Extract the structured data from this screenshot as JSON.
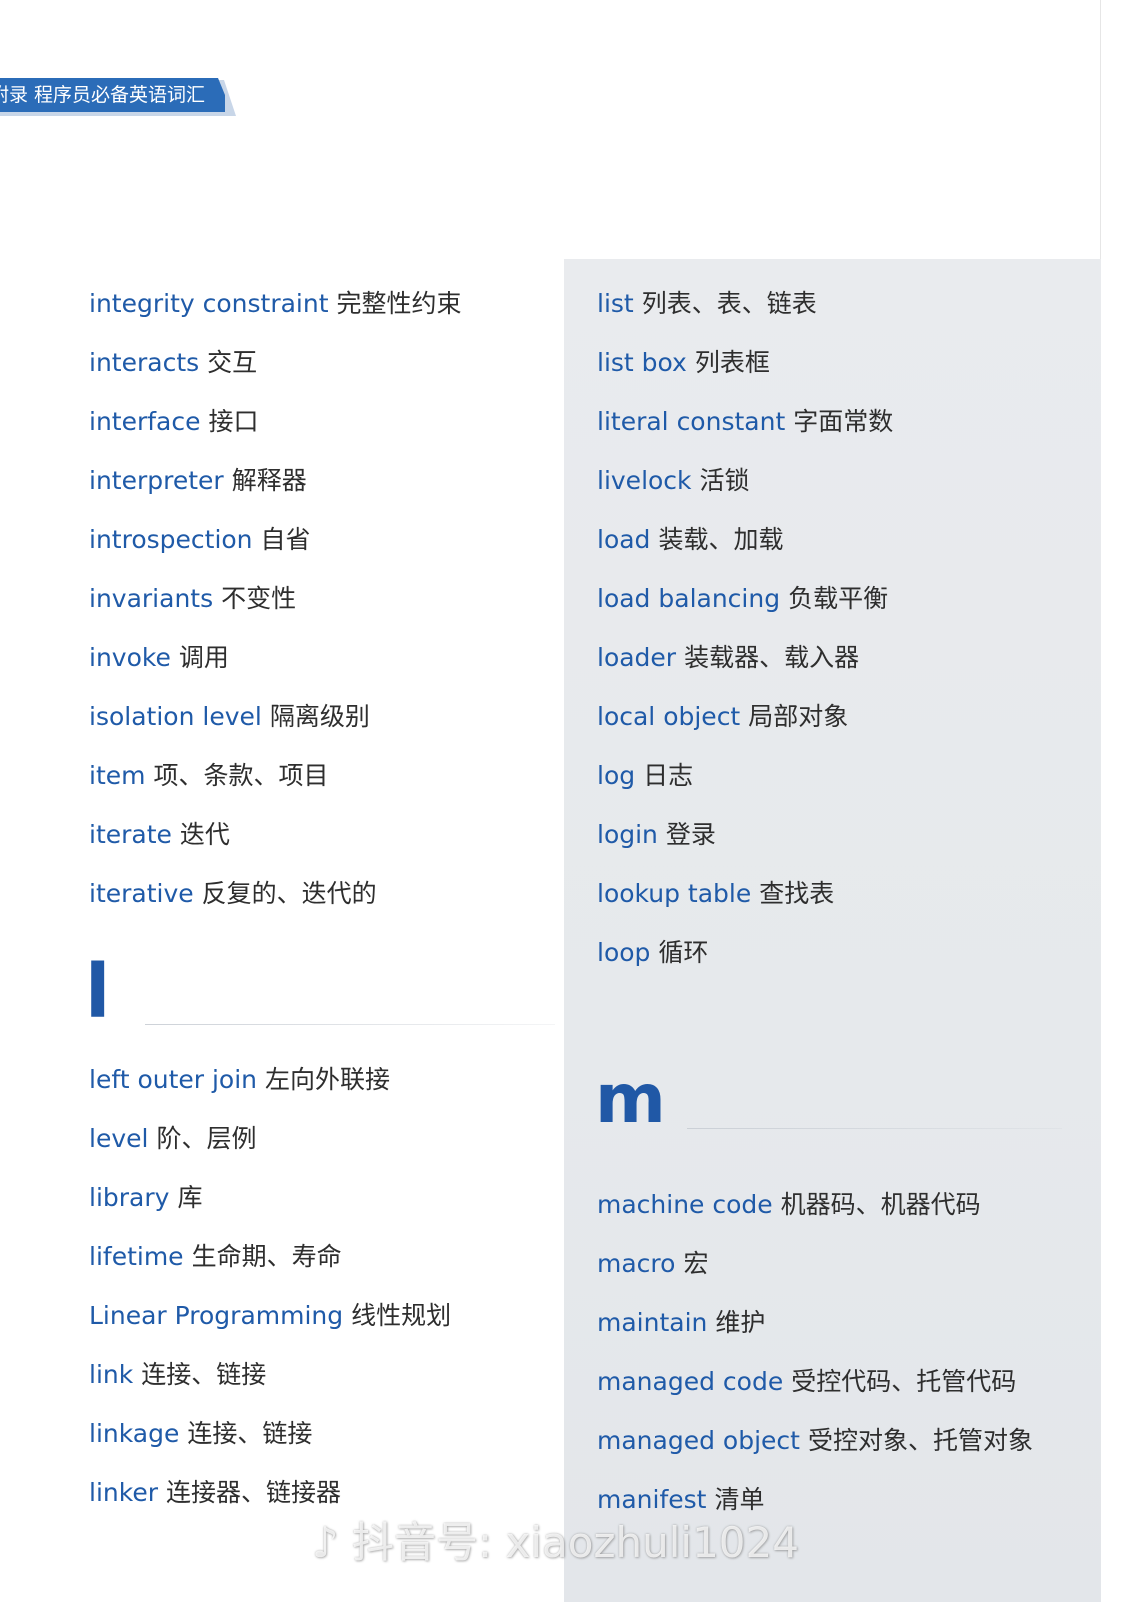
{
  "header": {
    "title": "附录 程序员必备英语词汇"
  },
  "left_column": {
    "entries_top": [
      {
        "en": "integrity constraint",
        "zh": "完整性约束"
      },
      {
        "en": "interacts",
        "zh": "交互"
      },
      {
        "en": "interface",
        "zh": "接口"
      },
      {
        "en": "interpreter",
        "zh": "解释器"
      },
      {
        "en": "introspection",
        "zh": "自省"
      },
      {
        "en": "invariants",
        "zh": "不变性"
      },
      {
        "en": "invoke",
        "zh": "调用"
      },
      {
        "en": "isolation level",
        "zh": "隔离级别"
      },
      {
        "en": "item",
        "zh": "项、条款、项目"
      },
      {
        "en": "iterate",
        "zh": "迭代"
      },
      {
        "en": "iterative",
        "zh": "反复的、迭代的"
      }
    ],
    "section_letter": "l",
    "entries_bottom": [
      {
        "en": "left outer join",
        "zh": "左向外联接"
      },
      {
        "en": "level",
        "zh": "阶、层例"
      },
      {
        "en": "library",
        "zh": "库"
      },
      {
        "en": "lifetime",
        "zh": "生命期、寿命"
      },
      {
        "en": "Linear Programming",
        "zh": "线性规划"
      },
      {
        "en": "link",
        "zh": "连接、链接"
      },
      {
        "en": "linkage",
        "zh": "连接、链接"
      },
      {
        "en": "linker",
        "zh": "连接器、链接器"
      }
    ]
  },
  "right_column": {
    "entries_top": [
      {
        "en": "list",
        "zh": "列表、表、链表"
      },
      {
        "en": "list box",
        "zh": "列表框"
      },
      {
        "en": "literal constant",
        "zh": "字面常数"
      },
      {
        "en": "livelock",
        "zh": "活锁"
      },
      {
        "en": "load",
        "zh": "装载、加载"
      },
      {
        "en": "load balancing",
        "zh": "负载平衡"
      },
      {
        "en": "loader",
        "zh": "装载器、载入器"
      },
      {
        "en": "local object",
        "zh": "局部对象"
      },
      {
        "en": "log",
        "zh": "日志"
      },
      {
        "en": "login",
        "zh": "登录"
      },
      {
        "en": "lookup table",
        "zh": "查找表"
      },
      {
        "en": "loop",
        "zh": "循环"
      }
    ],
    "section_letter": "m",
    "entries_bottom": [
      {
        "en": "machine code",
        "zh": "机器码、机器代码"
      },
      {
        "en": "macro",
        "zh": "宏"
      },
      {
        "en": "maintain",
        "zh": "维护"
      },
      {
        "en": "managed code",
        "zh": "受控代码、托管代码"
      },
      {
        "en": "managed object",
        "zh": "受控对象、托管对象"
      },
      {
        "en": "manifest",
        "zh": "清单"
      }
    ]
  },
  "watermark": {
    "logo_icon": "douyin-note-icon",
    "text": "抖音号: xiaozhuli1024"
  },
  "colors": {
    "accent": "#2b6cb8",
    "term": "#1f5aa8",
    "shade": "#e7e9ec"
  }
}
